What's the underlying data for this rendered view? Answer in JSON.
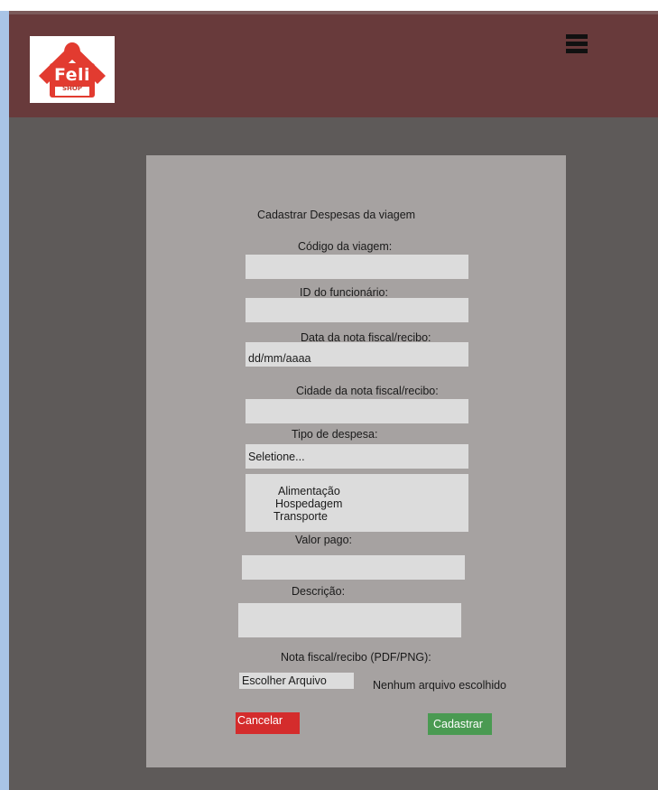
{
  "header": {
    "logo_text": "Feli",
    "logo_subtext": "SHOP",
    "menu_icon": "hamburger-menu-icon"
  },
  "form": {
    "title": "Cadastrar Despesas da viagem",
    "trip_code_label": "Código da viagem:",
    "trip_code_value": "",
    "employee_id_label": "ID do funcionário:",
    "employee_id_value": "",
    "date_label": "Data da nota fiscal/recibo:",
    "date_placeholder": "dd/mm/aaaa",
    "city_label": "Cidade da nota fiscal/recibo:",
    "city_value": "",
    "expense_type_label": "Tipo de despesa:",
    "expense_type_selected": "Seletione...",
    "expense_type_options": [
      "Alimentação",
      "Hospedagem",
      "Transporte"
    ],
    "amount_label": "Valor pago:",
    "amount_value": "",
    "description_label": "Descrição:",
    "description_value": "",
    "file_label": "Nota fiscal/recibo (PDF/PNG):",
    "file_button": "Escolher Arquivo",
    "file_status": "Nenhum arquivo escolhido",
    "cancel_label": "Cancelar",
    "submit_label": "Cadastrar"
  },
  "colors": {
    "header_bg": "#683a3b",
    "page_bg": "#5e5a59",
    "card_bg": "#a6a2a1",
    "field_bg": "#dcdcdc",
    "cancel_bg": "#d42c2c",
    "submit_bg": "#4a9a52",
    "logo_red": "#e23b30"
  }
}
